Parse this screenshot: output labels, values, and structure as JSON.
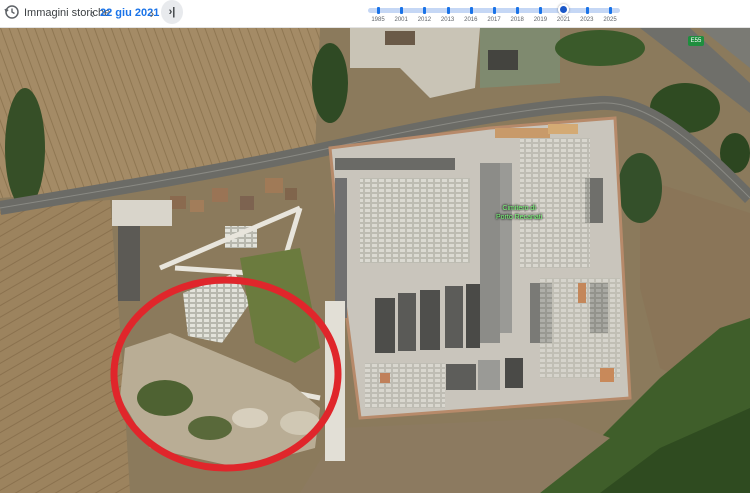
{
  "toolbar": {
    "title": "Immagini storiche",
    "date": "22 giu 2021",
    "prev_icon": "chevron-left-icon",
    "next_icon": "chevron-right-icon",
    "latest_icon": "skip-to-latest-icon"
  },
  "timeline": {
    "years": [
      "1985",
      "2001",
      "2012",
      "2013",
      "2016",
      "2017",
      "2018",
      "2019",
      "2021",
      "2023",
      "2025"
    ],
    "selected": "2021",
    "accent": "#1a73e8"
  },
  "map": {
    "cemetery_label_line1": "Cimitero di",
    "cemetery_label_line2": "Porto Recanati",
    "road_shield": "E55",
    "highlight_color": "#e0262b"
  }
}
